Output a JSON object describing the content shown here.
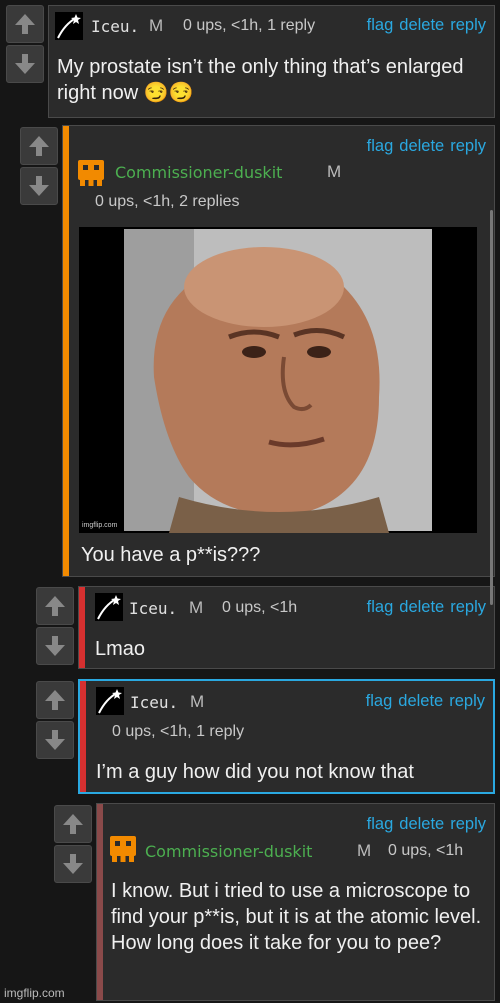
{
  "actions": {
    "flag": "flag",
    "delete": "delete",
    "reply": "reply"
  },
  "mod_badge": "M",
  "colors": {
    "accent_link": "#2aa8e0",
    "orange": "#f28a00",
    "red": "#d63030",
    "blue": "#2aa8e0",
    "brown": "#8a4a4a",
    "green_user": "#4caf50"
  },
  "comments": [
    {
      "user": "Iceu.",
      "meta": "0 ups, <1h, 1 reply",
      "text": "My prostate isn’t the only thing that’s enlarged right now 😏😏"
    },
    {
      "user": "Commissioner-duskit",
      "meta": "0 ups, <1h, 2 replies",
      "text": "You have a p**is???",
      "meme_watermark": "imgflip.com"
    },
    {
      "user": "Iceu.",
      "meta": "0 ups, <1h",
      "text": "Lmao"
    },
    {
      "user": "Iceu.",
      "meta": "0 ups, <1h, 1 reply",
      "text": "I’m a guy how did you not know that"
    },
    {
      "user": "Commissioner-duskit",
      "meta": "0 ups, <1h",
      "text": "I know. But i tried to use a microscope to find your p**is, but it is at the atomic level. How long does it take for you to pee?"
    }
  ],
  "watermark": "imgflip.com"
}
